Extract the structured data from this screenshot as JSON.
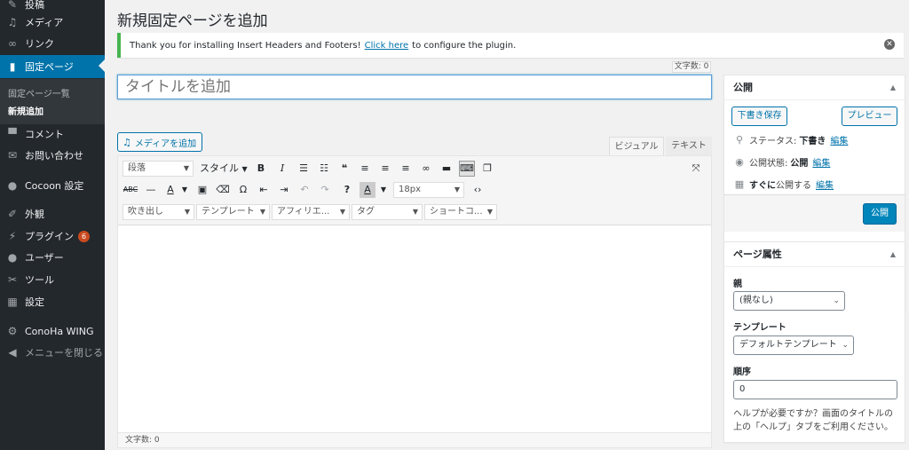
{
  "sidebar": {
    "items": [
      {
        "label": "投稿",
        "icon": "pin-icon"
      },
      {
        "label": "メディア",
        "icon": "media-icon"
      },
      {
        "label": "リンク",
        "icon": "link-icon"
      },
      {
        "label": "固定ページ",
        "icon": "page-icon"
      },
      {
        "label": "コメント",
        "icon": "comment-icon"
      },
      {
        "label": "お問い合わせ",
        "icon": "mail-icon"
      },
      {
        "label": "Cocoon 設定",
        "icon": "cocoon-icon"
      },
      {
        "label": "外観",
        "icon": "brush-icon"
      },
      {
        "label": "プラグイン",
        "icon": "plugin-icon",
        "badge": "6"
      },
      {
        "label": "ユーザー",
        "icon": "user-icon"
      },
      {
        "label": "ツール",
        "icon": "wrench-icon"
      },
      {
        "label": "設定",
        "icon": "settings-icon"
      },
      {
        "label": "ConoHa WING",
        "icon": "gear-icon"
      },
      {
        "label": "メニューを閉じる",
        "icon": "collapse-icon"
      }
    ],
    "submenu": [
      "固定ページ一覧",
      "新規追加"
    ]
  },
  "page_title": "新規固定ページを追加",
  "notice": {
    "text_before": "Thank you for installing Insert Headers and Footers!",
    "link": "Click here",
    "text_after": "to configure the plugin."
  },
  "title_field": {
    "wordcount": "文字数: 0",
    "placeholder": "タイトルを追加"
  },
  "editor": {
    "add_media": "メディアを追加",
    "tabs": [
      "ビジュアル",
      "テキスト"
    ],
    "format_select": "段落",
    "style_select": "スタイル",
    "font_size": "18px",
    "row3_selects": [
      "吹き出し",
      "テンプレート",
      "アフィリエ...",
      "タグ",
      "ショートコ..."
    ],
    "footer_wordcount": "文字数: 0"
  },
  "publish_box": {
    "title": "公開",
    "save_draft": "下書き保存",
    "preview": "プレビュー",
    "status_label": "ステータス:",
    "status_value": "下書き",
    "visibility_label": "公開状態:",
    "visibility_value": "公開",
    "schedule_value": "すぐに",
    "schedule_label": "公開する",
    "edit": "編集",
    "publish": "公開"
  },
  "attributes_box": {
    "title": "ページ属性",
    "parent_label": "親",
    "parent_value": "(親なし)",
    "template_label": "テンプレート",
    "template_value": "デフォルトテンプレート",
    "order_label": "順序",
    "order_value": "0",
    "help": "ヘルプが必要ですか？画面のタイトルの上の「ヘルプ」タブをご利用ください。"
  }
}
